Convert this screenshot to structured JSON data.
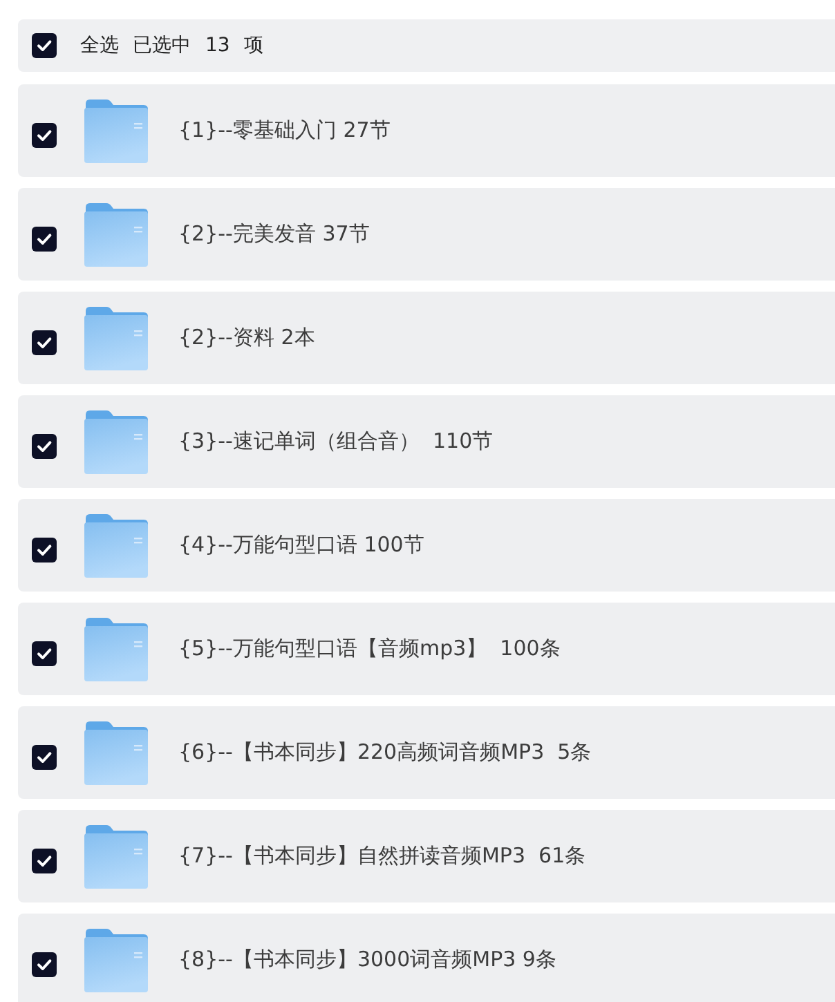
{
  "header": {
    "checked": true,
    "label": "全选",
    "summary": "已选中 13 项"
  },
  "items": [
    {
      "name": "{1}--零基础入门 27节",
      "checked": true
    },
    {
      "name": "{2}--完美发音 37节",
      "checked": true
    },
    {
      "name": "{2}--资料 2本",
      "checked": true
    },
    {
      "name": "{3}--速记单词（组合音）  110节",
      "checked": true
    },
    {
      "name": "{4}--万能句型口语 100节",
      "checked": true
    },
    {
      "name": "{5}--万能句型口语【音频mp3】  100条",
      "checked": true
    },
    {
      "name": "{6}--【书本同步】220高频词音频MP3  5条",
      "checked": true
    },
    {
      "name": "{7}--【书本同步】自然拼读音频MP3  61条",
      "checked": true
    },
    {
      "name": "{8}--【书本同步】3000词音频MP3 9条",
      "checked": true
    }
  ]
}
